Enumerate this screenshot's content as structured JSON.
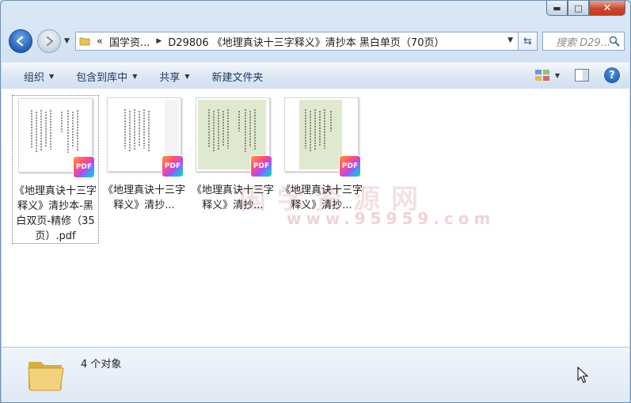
{
  "window": {
    "min_label": "▬",
    "max_label": "□",
    "close_label": "✕"
  },
  "nav": {
    "address_crumbs": [
      "国学资...",
      "D29806 《地理真诀十三字释义》清抄本 黑白单页（70页）"
    ],
    "address_chevrons": "«",
    "search_placeholder": "搜索 D29..."
  },
  "toolbar": {
    "organize": "组织",
    "include_in_library": "包含到库中",
    "share": "共享",
    "new_folder": "新建文件夹"
  },
  "files": [
    {
      "name": "《地理真诀十三字释义》清抄本-黑白双页-精修（35页）.pdf",
      "badge": "PDF",
      "selected": true
    },
    {
      "name": "《地理真诀十三字释义》清抄...",
      "badge": "PDF",
      "selected": false
    },
    {
      "name": "《地理真诀十三字释义》清抄...",
      "badge": "PDF",
      "selected": false
    },
    {
      "name": "《地理真诀十三字释义》清抄...",
      "badge": "PDF",
      "selected": false
    }
  ],
  "watermark": {
    "text": "国学资源网",
    "url": "www.95959.com"
  },
  "details": {
    "count_text": "4 个对象"
  },
  "colors": {
    "page_green": "#dfe9cf",
    "page_white": "#ffffff",
    "accent": "#1f5fb8"
  }
}
